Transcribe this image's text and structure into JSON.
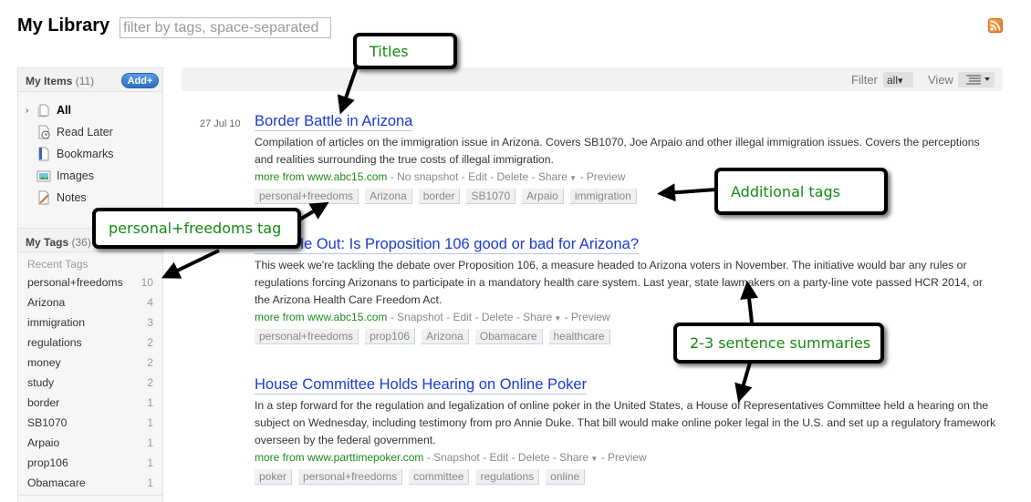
{
  "header": {
    "title": "My Library",
    "filter_placeholder": "filter by tags, space-separated",
    "rss_icon": "rss-feed-icon"
  },
  "sidebar": {
    "my_items": {
      "label": "My Items",
      "count": "(11)",
      "add_label": "Add+"
    },
    "items": [
      {
        "label": "All",
        "icon": "all-items-icon",
        "active": true
      },
      {
        "label": "Read Later",
        "icon": "read-later-clock-icon"
      },
      {
        "label": "Bookmarks",
        "icon": "bookmark-icon"
      },
      {
        "label": "Images",
        "icon": "image-icon"
      },
      {
        "label": "Notes",
        "icon": "note-pencil-icon"
      }
    ],
    "my_tags": {
      "label": "My Tags",
      "count": "(36)"
    },
    "recent_label": "Recent Tags",
    "tags": [
      {
        "name": "personal+freedoms",
        "count": "10"
      },
      {
        "name": "Arizona",
        "count": "4"
      },
      {
        "name": "immigration",
        "count": "3"
      },
      {
        "name": "regulations",
        "count": "2"
      },
      {
        "name": "money",
        "count": "2"
      },
      {
        "name": "study",
        "count": "2"
      },
      {
        "name": "border",
        "count": "1"
      },
      {
        "name": "SB1070",
        "count": "1"
      },
      {
        "name": "Arpaio",
        "count": "1"
      },
      {
        "name": "prop106",
        "count": "1"
      },
      {
        "name": "Obamacare",
        "count": "1"
      }
    ]
  },
  "toolbar": {
    "filter_label": "Filter",
    "filter_value": "all",
    "view_label": "View",
    "caret": "▾"
  },
  "entries": [
    {
      "date": "27 Jul 10",
      "title": "Border Battle in Arizona",
      "summary": "Compilation of articles on the immigration issue in Arizona. Covers SB1070, Joe Arpaio and other illegal immigration issues. Covers the perceptions and realities surrounding the true costs of illegal immigration.",
      "source": "more from www.abc15.com",
      "snapshot": "No snapshot",
      "edit": "Edit",
      "delete": "Delete",
      "share": "Share",
      "preview": "Preview",
      "tags": [
        "personal+freedoms",
        "Arizona",
        "border",
        "SB1070",
        "Arpaio",
        "immigration"
      ]
    },
    {
      "date": "",
      "title": "Hear Me Out: Is Proposition 106 good or bad for Arizona?",
      "summary": "This week we're tackling the debate over Proposition 106, a measure headed to Arizona voters in November. The initiative would bar any rules or regulations forcing Arizonans to participate in a mandatory health care system. Last year, state lawmakers on a party-line vote passed HCR 2014, or the Arizona Health Care Freedom Act.",
      "source": "more from www.abc15.com",
      "snapshot": "Snapshot",
      "edit": "Edit",
      "delete": "Delete",
      "share": "Share",
      "preview": "Preview",
      "tags": [
        "personal+freedoms",
        "prop106",
        "Arizona",
        "Obamacare",
        "healthcare"
      ]
    },
    {
      "date": "",
      "title": "House Committee Holds Hearing on Online Poker",
      "summary": "In a step forward for the regulation and legalization of online poker in the United States, a House of Representatives Committee held a hearing on the subject on Wednesday, including testimony from pro Annie Duke. That bill would make online poker legal in the U.S. and set up a regulatory framework overseen by the federal government.",
      "source": "more from www.parttimepoker.com",
      "snapshot": "Snapshot",
      "edit": "Edit",
      "delete": "Delete",
      "share": "Share",
      "preview": "Preview",
      "tags": [
        "poker",
        "personal+freedoms",
        "committee",
        "regulations",
        "online"
      ]
    }
  ],
  "annotations": {
    "titles": "Titles",
    "additional_tags": "Additional tags",
    "pf_tag": "personal+freedoms tag",
    "summaries": "2-3 sentence summaries"
  },
  "colors": {
    "title_link": "#1a3ad6",
    "source_link": "#1d8a1d",
    "add_button": "#2c6fc4",
    "annotation_text": "#138a13"
  }
}
